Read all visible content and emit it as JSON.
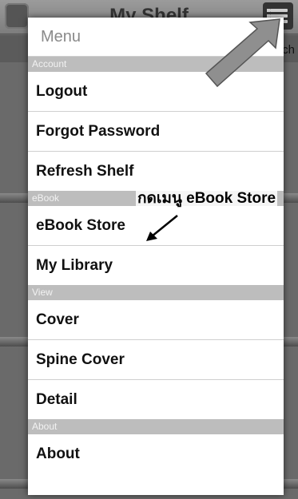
{
  "app": {
    "title": "My Shelf",
    "search_peek": "ch",
    "icons": {
      "logo": "app-logo-icon",
      "menu": "menu-list-icon"
    }
  },
  "menu": {
    "title": "Menu",
    "sections": [
      {
        "label": "Account",
        "items": [
          "Logout",
          "Forgot Password",
          "Refresh Shelf"
        ]
      },
      {
        "label": "eBook",
        "items": [
          "eBook Store",
          "My Library"
        ]
      },
      {
        "label": "View",
        "items": [
          "Cover",
          "Spine Cover",
          "Detail"
        ]
      },
      {
        "label": "About",
        "items": [
          "About"
        ]
      }
    ]
  },
  "annotation": {
    "text": "กดเมนู eBook Store"
  },
  "colors": {
    "section_bg": "#bdbdbd",
    "menu_bg": "#ffffff",
    "arrow": "#8a8a8a"
  }
}
